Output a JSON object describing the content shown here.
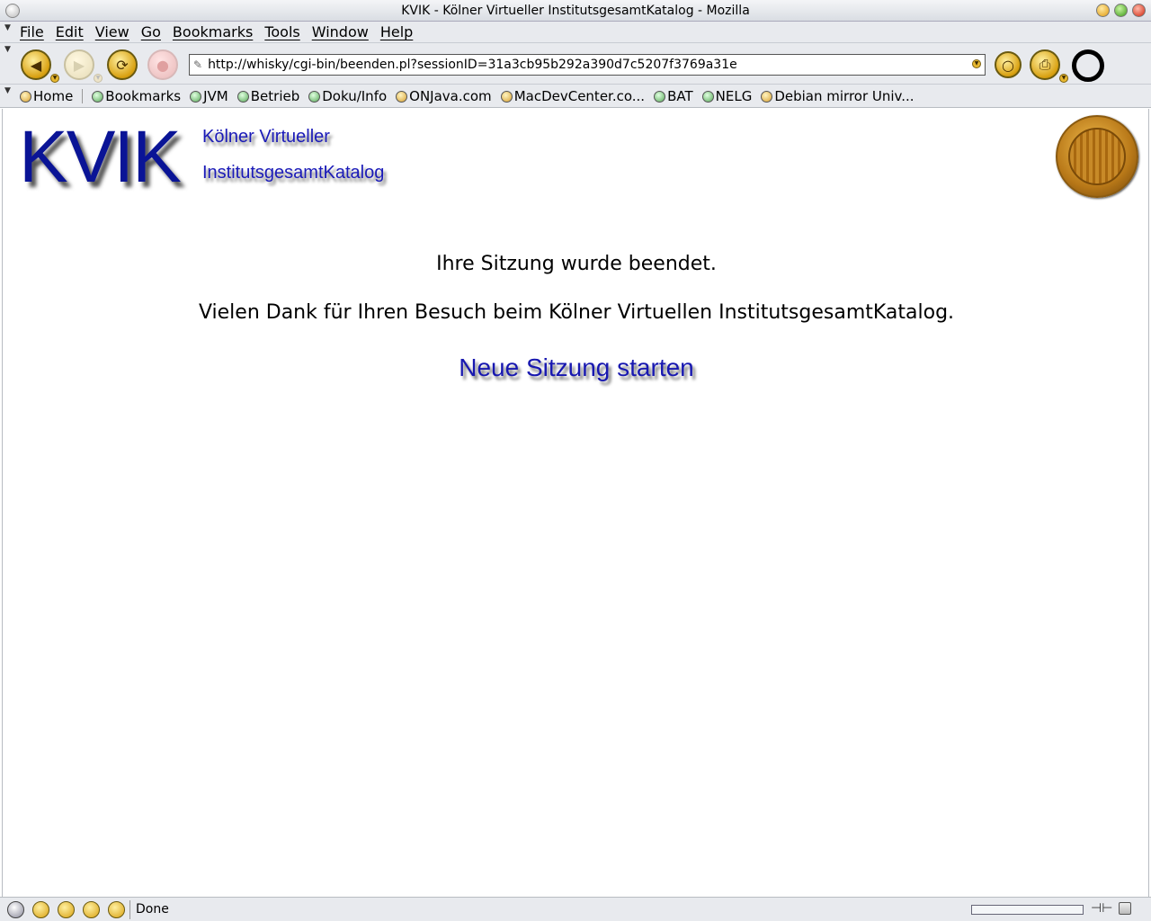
{
  "window": {
    "title": "KVIK - Kölner Virtueller InstitutsgesamtKatalog - Mozilla"
  },
  "menu": [
    "File",
    "Edit",
    "View",
    "Go",
    "Bookmarks",
    "Tools",
    "Window",
    "Help"
  ],
  "navbar": {
    "url": "http://whisky/cgi-bin/beenden.pl?sessionID=31a3cb95b292a390d7c5207f3769a31e",
    "icons": [
      "back-icon",
      "forward-icon",
      "reload-icon",
      "stop-icon",
      "search-icon",
      "print-icon",
      "throbber"
    ]
  },
  "bookmarks": {
    "home": "Home",
    "items": [
      "Bookmarks",
      "JVM",
      "Betrieb",
      "Doku/Info",
      "ONJava.com",
      "MacDevCenter.co...",
      "BAT",
      "NELG",
      "Debian mirror Univ..."
    ]
  },
  "page": {
    "logo": "KVIK",
    "subtitle_line1": "Kölner Virtueller",
    "subtitle_line2": "InstitutsgesamtKatalog",
    "message1": "Ihre Sitzung wurde beendet.",
    "message2": "Vielen Dank für Ihren Besuch beim Kölner Virtuellen InstitutsgesamtKatalog.",
    "link": "Neue Sitzung starten",
    "colors": {
      "logo": "#0a1496",
      "link": "#1818b0"
    }
  },
  "status": {
    "text": "Done"
  }
}
